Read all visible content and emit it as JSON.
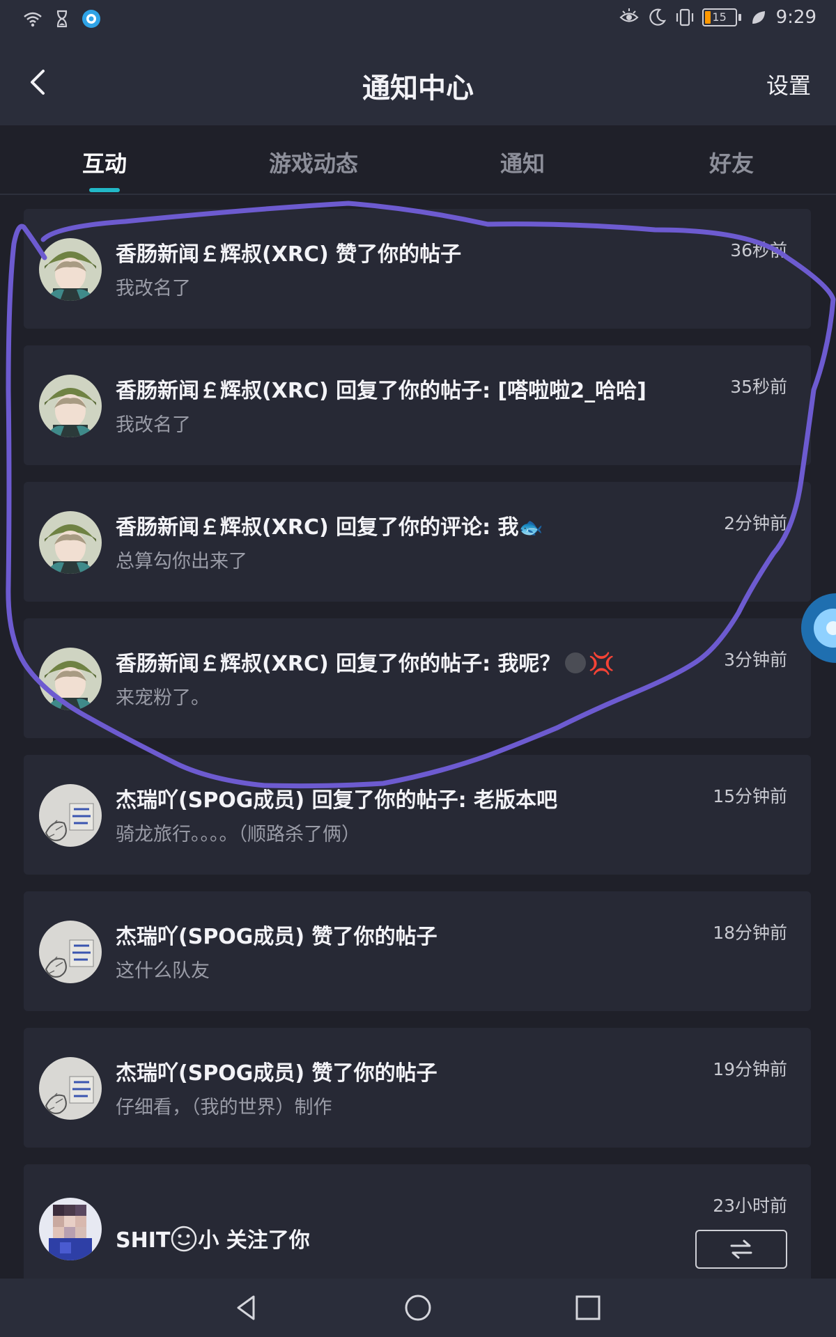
{
  "status_bar": {
    "time": "9:29",
    "battery_level": "15",
    "icons": [
      "wifi-icon",
      "hourglass-icon",
      "app-notification-icon",
      "eye-comfort-icon",
      "moon-icon",
      "vibrate-icon",
      "battery-icon",
      "leaf-icon"
    ]
  },
  "header": {
    "title": "通知中心",
    "settings_label": "设置",
    "back_icon": "back-arrow-icon"
  },
  "tabs": [
    {
      "label": "互动",
      "active": true
    },
    {
      "label": "游戏动态",
      "active": false
    },
    {
      "label": "通知",
      "active": false
    },
    {
      "label": "好友",
      "active": false
    }
  ],
  "notifications": [
    {
      "title": "香肠新闻￡辉叔(XRC) 赞了你的帖子",
      "subtitle": "我改名了",
      "time": "36秒前",
      "avatar": "avatar-cap"
    },
    {
      "title": "香肠新闻￡辉叔(XRC) 回复了你的帖子: [嗒啦啦2_哈哈]",
      "subtitle": "我改名了",
      "time": "35秒前",
      "avatar": "avatar-cap"
    },
    {
      "title": "香肠新闻￡辉叔(XRC) 回复了你的评论: 我",
      "subtitle": "总算勾你出来了",
      "time": "2分钟前",
      "avatar": "avatar-cap"
    },
    {
      "title": "香肠新闻￡辉叔(XRC) 回复了你的帖子: 我呢？",
      "subtitle": "来宠粉了。",
      "time": "3分钟前",
      "avatar": "avatar-cap"
    },
    {
      "title": "杰瑞吖(SPOG成员) 回复了你的帖子: 老版本吧",
      "subtitle": "骑龙旅行。。。。（顺路杀了俩）",
      "time": "15分钟前",
      "avatar": "avatar-sketch"
    },
    {
      "title": "杰瑞吖(SPOG成员) 赞了你的帖子",
      "subtitle": "这什么队友",
      "time": "18分钟前",
      "avatar": "avatar-sketch"
    },
    {
      "title": "杰瑞吖(SPOG成员) 赞了你的帖子",
      "subtitle": "仔细看，（我的世界）制作",
      "time": "19分钟前",
      "avatar": "avatar-sketch"
    }
  ],
  "follow_item": {
    "title_prefix": "SHIT",
    "title_suffix": "小 关注了你",
    "time": "23小时前",
    "toggle_icon": "swap-arrows-icon"
  },
  "nav_bar": {
    "buttons": [
      "nav-back-icon",
      "nav-home-icon",
      "nav-recents-icon"
    ]
  },
  "colors": {
    "accent": "#22b8c7",
    "annotation_stroke": "#6d5bd0",
    "background": "#1f2029",
    "card": "#272935"
  }
}
